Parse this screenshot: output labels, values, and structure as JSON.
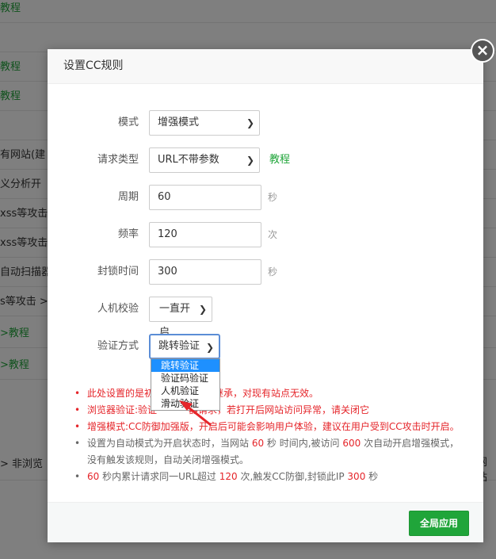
{
  "background": {
    "rows": [
      {
        "text": "教程",
        "green": true
      },
      {
        "text": "教程",
        "green": true
      },
      {
        "text": "教程",
        "green": true
      },
      {
        "text": "",
        "green": false
      },
      {
        "text": "有网站(建",
        "green": false
      },
      {
        "text": "义分析开",
        "green": false
      },
      {
        "text": "xss等攻击",
        "green": false
      },
      {
        "text": "xss等攻击",
        "green": false
      },
      {
        "text": "自动扫描器",
        "green": false
      },
      {
        "text": "s等攻击 >",
        "green": false
      },
      {
        "text": ">教程",
        "green": true
      },
      {
        "text": " >教程",
        "green": true
      }
    ],
    "bottom_left": " > 非浏览",
    "bottom_right": "网站"
  },
  "modal": {
    "title": "设置CC规则",
    "close_label": "×",
    "fields": {
      "mode": {
        "label": "模式",
        "value": "增强模式"
      },
      "request_type": {
        "label": "请求类型",
        "value": "URL不带参数",
        "link": "教程"
      },
      "period": {
        "label": "周期",
        "value": "60",
        "unit": "秒"
      },
      "frequency": {
        "label": "频率",
        "value": "120",
        "unit": "次"
      },
      "block_time": {
        "label": "封锁时间",
        "value": "300",
        "unit": "秒"
      },
      "captcha": {
        "label": "人机校验",
        "value": "一直开启"
      },
      "verify_method": {
        "label": "验证方式",
        "value": "跳转验证"
      }
    },
    "dropdown_options": [
      "跳转验证",
      "验证码验证",
      "人机验证",
      "滑动验证"
    ],
    "notes": {
      "n1": "此处设置的是初",
      "n1b": "点时将继承，对现有站点无效。",
      "n2": "浏览器验证:验证",
      "n2b": "器请求，若打开后网站访问异常，请关闭它",
      "n3": "增强模式:CC防御加强版，",
      "n3b": "开启后可能会影响用户体验，建议在用户受到CC攻击时开启。",
      "n4a": "设置为自动模式为开启状态时，当网站 ",
      "n4b": "60",
      "n4c": " 秒 时间内,被访问 ",
      "n4d": "600",
      "n4e": " 次自动开启增强模式，",
      "n4f": "没有触发该规则，自动关闭增强模式。",
      "n5a": "60",
      "n5b": " 秒内累计请求同一URL超过 ",
      "n5c": "120",
      "n5d": " 次,触发CC防御,封锁此IP ",
      "n5e": "300",
      "n5f": " 秒"
    },
    "apply_label": "全局应用"
  }
}
